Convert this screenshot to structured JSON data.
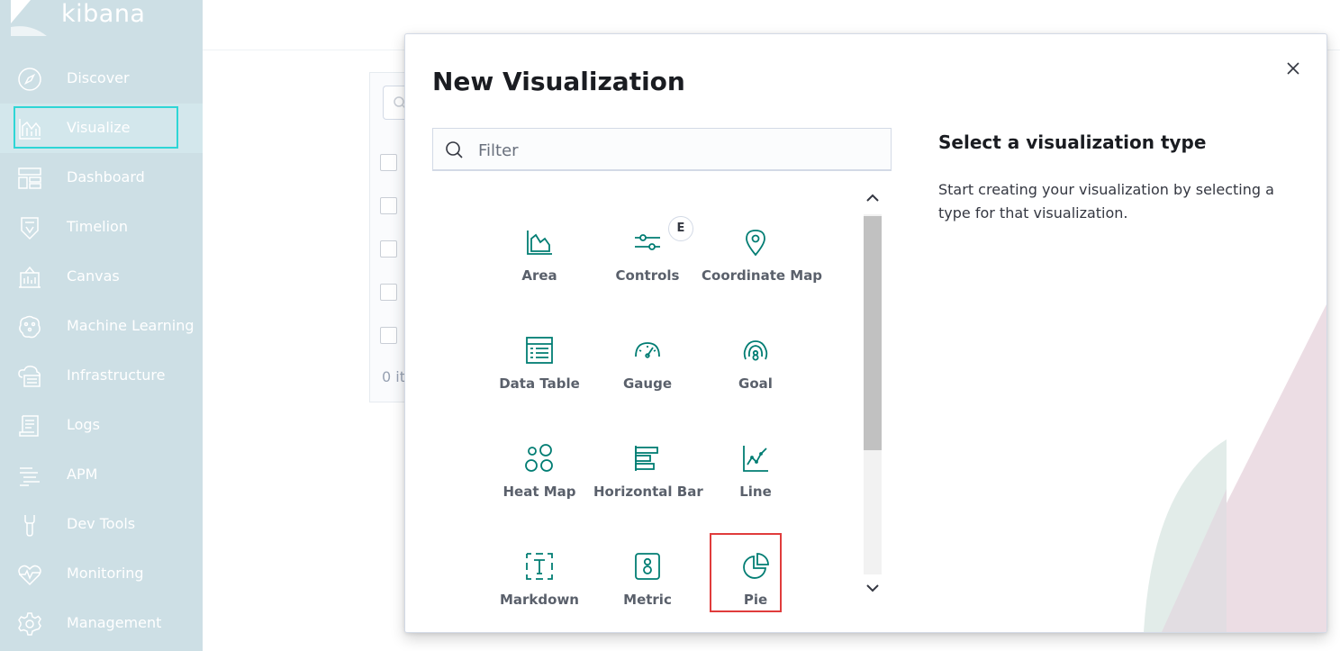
{
  "brand": {
    "name": "kibana"
  },
  "sidebar": {
    "items": [
      {
        "label": "Discover",
        "icon": "compass-icon"
      },
      {
        "label": "Visualize",
        "icon": "visualize-icon",
        "active": true
      },
      {
        "label": "Dashboard",
        "icon": "dashboard-icon"
      },
      {
        "label": "Timelion",
        "icon": "timelion-icon"
      },
      {
        "label": "Canvas",
        "icon": "canvas-icon"
      },
      {
        "label": "Machine Learning",
        "icon": "machine-learning-icon"
      },
      {
        "label": "Infrastructure",
        "icon": "infrastructure-icon"
      },
      {
        "label": "Logs",
        "icon": "logs-icon"
      },
      {
        "label": "APM",
        "icon": "apm-icon"
      },
      {
        "label": "Dev Tools",
        "icon": "wrench-icon"
      },
      {
        "label": "Monitoring",
        "icon": "heartbeat-icon"
      },
      {
        "label": "Management",
        "icon": "gear-icon"
      }
    ]
  },
  "background": {
    "items_text": "0 it"
  },
  "modal": {
    "title": "New Visualization",
    "filter_placeholder": "Filter",
    "types": [
      {
        "label": "Area",
        "icon": "area-chart-icon"
      },
      {
        "label": "Controls",
        "icon": "controls-icon",
        "badge": "E"
      },
      {
        "label": "Coordinate Map",
        "icon": "map-pin-icon"
      },
      {
        "label": "Data Table",
        "icon": "table-icon"
      },
      {
        "label": "Gauge",
        "icon": "gauge-icon"
      },
      {
        "label": "Goal",
        "icon": "goal-icon"
      },
      {
        "label": "Heat Map",
        "icon": "heatmap-icon"
      },
      {
        "label": "Horizontal Bar",
        "icon": "horizontal-bar-icon"
      },
      {
        "label": "Line",
        "icon": "line-chart-icon"
      },
      {
        "label": "Markdown",
        "icon": "markdown-icon"
      },
      {
        "label": "Metric",
        "icon": "metric-icon"
      },
      {
        "label": "Pie",
        "icon": "pie-chart-icon",
        "highlighted": true
      }
    ],
    "info_title": "Select a visualization type",
    "info_text": "Start creating your visualization by selecting a type for that visualization."
  },
  "colors": {
    "sidebar_bg": "#cddfe5",
    "accent": "#017d73",
    "active_outline": "#2ed6d6",
    "highlight_outline": "#e03c3c"
  }
}
